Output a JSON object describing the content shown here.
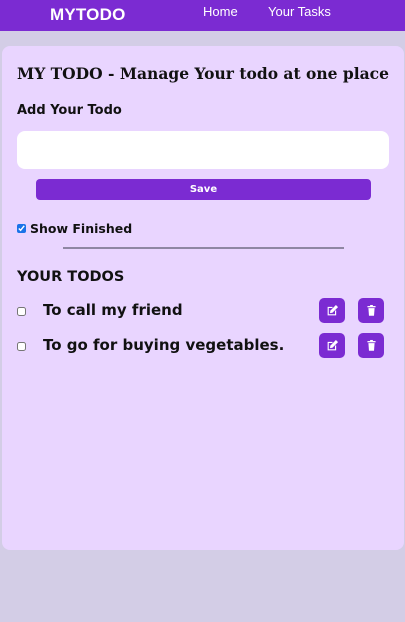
{
  "navbar": {
    "brand": "MYTODO",
    "links": [
      "Home",
      "Your Tasks"
    ]
  },
  "main": {
    "title": "MY TODO - Manage Your todo at one place",
    "add_heading": "Add Your Todo",
    "input": {
      "value": "",
      "placeholder": ""
    },
    "save_label": "Save",
    "show_finished": {
      "label": "Show Finished",
      "checked": true
    },
    "todos_heading": "YOUR TODOS",
    "todos": [
      {
        "text": "To call my friend",
        "done": false,
        "edit_icon": "edit-icon",
        "delete_icon": "trash-icon"
      },
      {
        "text": "To go for buying vegetables.",
        "done": false,
        "edit_icon": "edit-icon",
        "delete_icon": "trash-icon"
      }
    ]
  },
  "colors": {
    "accent": "#7b2bd2",
    "card_background": "#e9d5ff",
    "page_background": "#d3cde6"
  }
}
